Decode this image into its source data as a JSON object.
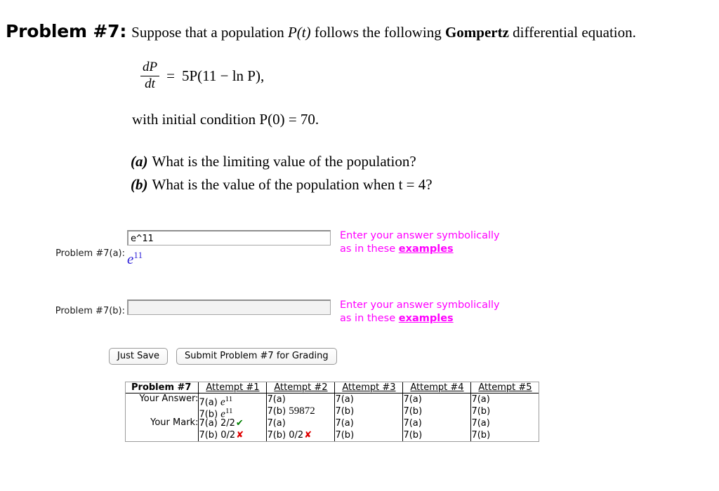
{
  "problem": {
    "label": "Problem #7:",
    "statement_pre": "Suppose that a population ",
    "statement_pt": "P(t)",
    "statement_mid": " follows the following ",
    "statement_bold": "Gompertz",
    "statement_post": " differential equation.",
    "equation": {
      "numerator": "dP",
      "denominator": "dt",
      "equals": "=",
      "rhs": "5P(11 − ln P),"
    },
    "initial_condition": "with initial condition P(0)  =  70.",
    "subquestions": [
      {
        "tag": "(a)",
        "text": "What is the limiting value of the population?"
      },
      {
        "tag": "(b)",
        "text": "What is the value of the population when t = 4?"
      }
    ]
  },
  "answers": [
    {
      "label": "Problem #7(a):",
      "value": "e^11",
      "placeholder": "",
      "hint_line1": "Enter your answer symbolically",
      "hint_line2_pre": "as in these ",
      "hint_link": "examples",
      "rendered_base": "e",
      "rendered_exp": "11"
    },
    {
      "label": "Problem #7(b):",
      "value": "",
      "placeholder": "",
      "hint_line1": "Enter your answer symbolically",
      "hint_line2_pre": "as in these ",
      "hint_link": "examples",
      "rendered_base": "",
      "rendered_exp": ""
    }
  ],
  "buttons": {
    "just_save": "Just Save",
    "submit": "Submit Problem #7 for Grading"
  },
  "attempts_table": {
    "corner_label": "Problem #7",
    "headers": [
      "Attempt #1",
      "Attempt #2",
      "Attempt #3",
      "Attempt #4",
      "Attempt #5"
    ],
    "row_labels": [
      "Your Answer:",
      "Your Mark:"
    ],
    "answers": [
      {
        "a_label": "7(a)",
        "a_value": "e",
        "a_exp": "11",
        "b_label": "7(b)",
        "b_value": "e",
        "b_exp": "11"
      },
      {
        "a_label": "7(a)",
        "a_value": "",
        "a_exp": "",
        "b_label": "7(b)",
        "b_value": "59872",
        "b_exp": ""
      },
      {
        "a_label": "7(a)",
        "a_value": "",
        "a_exp": "",
        "b_label": "7(b)",
        "b_value": "",
        "b_exp": ""
      },
      {
        "a_label": "7(a)",
        "a_value": "",
        "a_exp": "",
        "b_label": "7(b)",
        "b_value": "",
        "b_exp": ""
      },
      {
        "a_label": "7(a)",
        "a_value": "",
        "a_exp": "",
        "b_label": "7(b)",
        "b_value": "",
        "b_exp": ""
      }
    ],
    "marks": [
      {
        "a_label": "7(a)",
        "a_score": "2/2",
        "a_icon": "✔",
        "a_status": "correct",
        "b_label": "7(b)",
        "b_score": "0/2",
        "b_icon": "✘",
        "b_status": "incorrect"
      },
      {
        "a_label": "7(a)",
        "a_score": "",
        "a_icon": "",
        "a_status": "none",
        "b_label": "7(b)",
        "b_score": "0/2",
        "b_icon": "✘",
        "b_status": "incorrect"
      },
      {
        "a_label": "7(a)",
        "a_score": "",
        "a_icon": "",
        "a_status": "none",
        "b_label": "7(b)",
        "b_score": "",
        "b_icon": "",
        "b_status": "none"
      },
      {
        "a_label": "7(a)",
        "a_score": "",
        "a_icon": "",
        "a_status": "none",
        "b_label": "7(b)",
        "b_score": "",
        "b_icon": "",
        "b_status": "none"
      },
      {
        "a_label": "7(a)",
        "a_score": "",
        "a_icon": "",
        "a_status": "none",
        "b_label": "7(b)",
        "b_score": "",
        "b_icon": "",
        "b_status": "none"
      }
    ]
  },
  "colors": {
    "hint": "#ff00ff",
    "rendered_answer": "#2f22d8",
    "correct": "#008000",
    "incorrect": "#e00000"
  }
}
